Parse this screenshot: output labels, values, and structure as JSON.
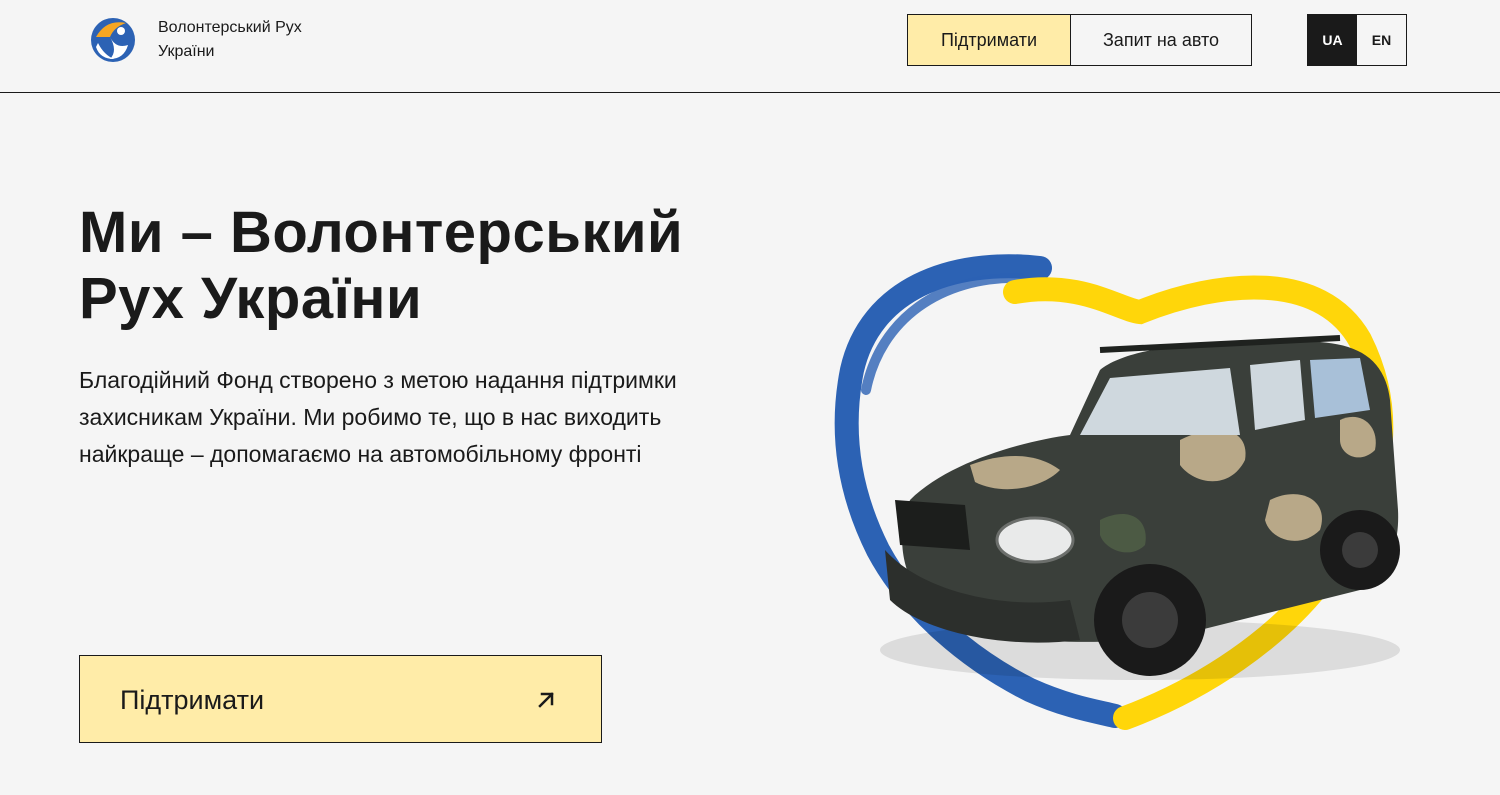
{
  "header": {
    "org_name": "Волонтерський Рух України",
    "support_label": "Підтримати",
    "request_label": "Запит на авто",
    "languages": [
      {
        "code": "UA",
        "active": true
      },
      {
        "code": "EN",
        "active": false
      }
    ]
  },
  "hero": {
    "title": "Ми – Волонтерський Рух України",
    "description": "Благодійний Фонд створено з метою надання підтримки захисникам України. Ми робимо те, що в нас виходить найкраще – допомагаємо на автомобільному фронті",
    "cta_label": "Підтримати"
  },
  "icons": {
    "logo": "logo-icon",
    "cta_arrow": "arrow-up-right-icon"
  },
  "colors": {
    "accent_yellow": "#ffeca8",
    "dark": "#1a1a1a",
    "background": "#f5f5f5",
    "flag_blue": "#2c62b4",
    "flag_yellow": "#ffd60a"
  }
}
